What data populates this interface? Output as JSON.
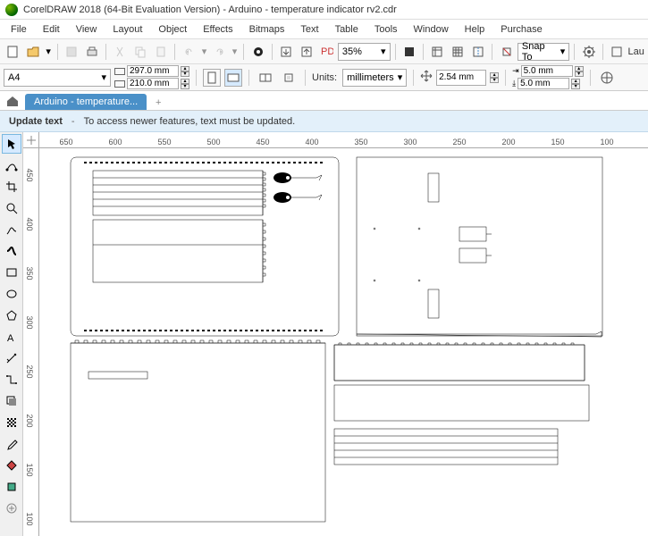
{
  "title": "CorelDRAW 2018 (64-Bit Evaluation Version) - Arduino - temperature indicator rv2.cdr",
  "menu": [
    "File",
    "Edit",
    "View",
    "Layout",
    "Object",
    "Effects",
    "Bitmaps",
    "Text",
    "Table",
    "Tools",
    "Window",
    "Help",
    "Purchase"
  ],
  "toolbar1": {
    "zoom": "35%",
    "snap": "Snap To",
    "lau": "Lau"
  },
  "toolbar2": {
    "paper": "A4",
    "width": "297.0 mm",
    "height": "210.0 mm",
    "units_label": "Units:",
    "units": "millimeters",
    "nudge": "2.54 mm",
    "dupx": "5.0 mm",
    "dupy": "5.0 mm"
  },
  "tab": {
    "name": "Arduino - temperature..."
  },
  "notice": {
    "bold": "Update text",
    "dash": "-",
    "msg": "To access newer features, text must be updated."
  },
  "ruler_h": [
    "650",
    "600",
    "550",
    "500",
    "450",
    "400",
    "350",
    "300",
    "250",
    "200",
    "150",
    "100"
  ],
  "ruler_v": [
    "450",
    "400",
    "350",
    "300",
    "250",
    "200",
    "150",
    "100"
  ]
}
